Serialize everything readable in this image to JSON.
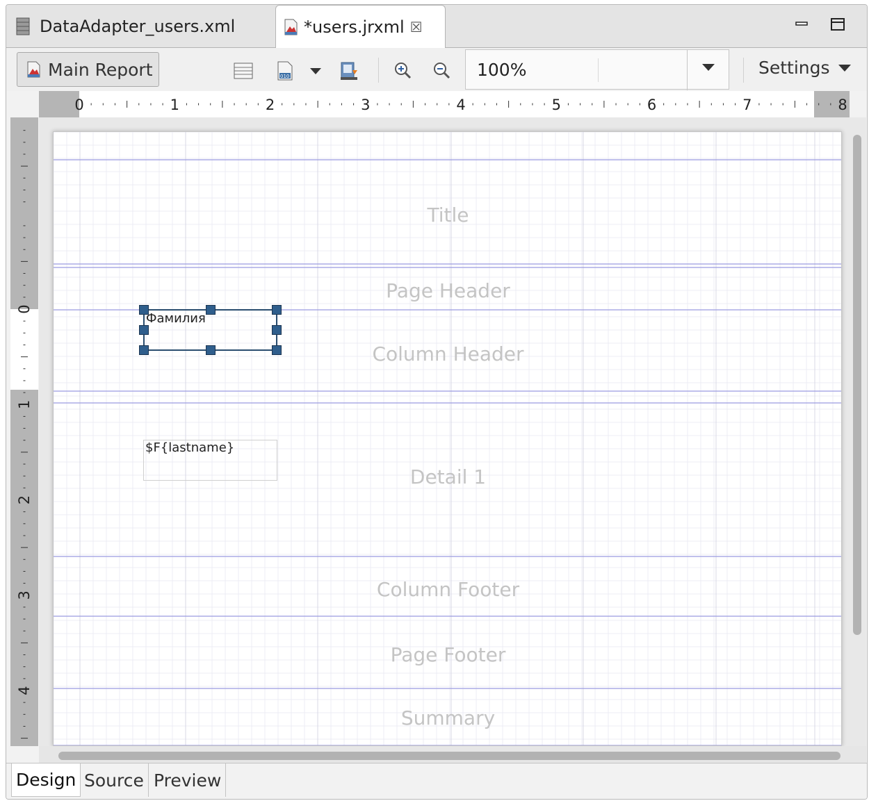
{
  "tabs": [
    {
      "label": "DataAdapter_users.xml",
      "icon": "data-adapter-icon",
      "active": false
    },
    {
      "label": "*users.jrxml",
      "icon": "report-file-icon",
      "active": true,
      "close_glyph": "☒"
    }
  ],
  "toolbar": {
    "main_report_label": "Main Report",
    "zoom_value": "100%",
    "settings_label": "Settings"
  },
  "hruler_labels": [
    "0",
    "1",
    "2",
    "3",
    "4",
    "5",
    "6",
    "7",
    "8"
  ],
  "vruler_labels": [
    "0",
    "1",
    "2",
    "3",
    "4"
  ],
  "bands": {
    "title": "Title",
    "page_header": "Page Header",
    "column_header": "Column Header",
    "detail": "Detail 1",
    "column_footer": "Column Footer",
    "page_footer": "Page Footer",
    "summary": "Summary"
  },
  "elements": {
    "static_text": "Фамилия",
    "text_field": "$F{lastname}"
  },
  "bottom_tabs": {
    "design": "Design",
    "source": "Source",
    "preview": "Preview"
  },
  "colors": {
    "grid_major": "#c9c9e6",
    "band_line": "#9b9be0",
    "selection": "#2f5e8c"
  }
}
